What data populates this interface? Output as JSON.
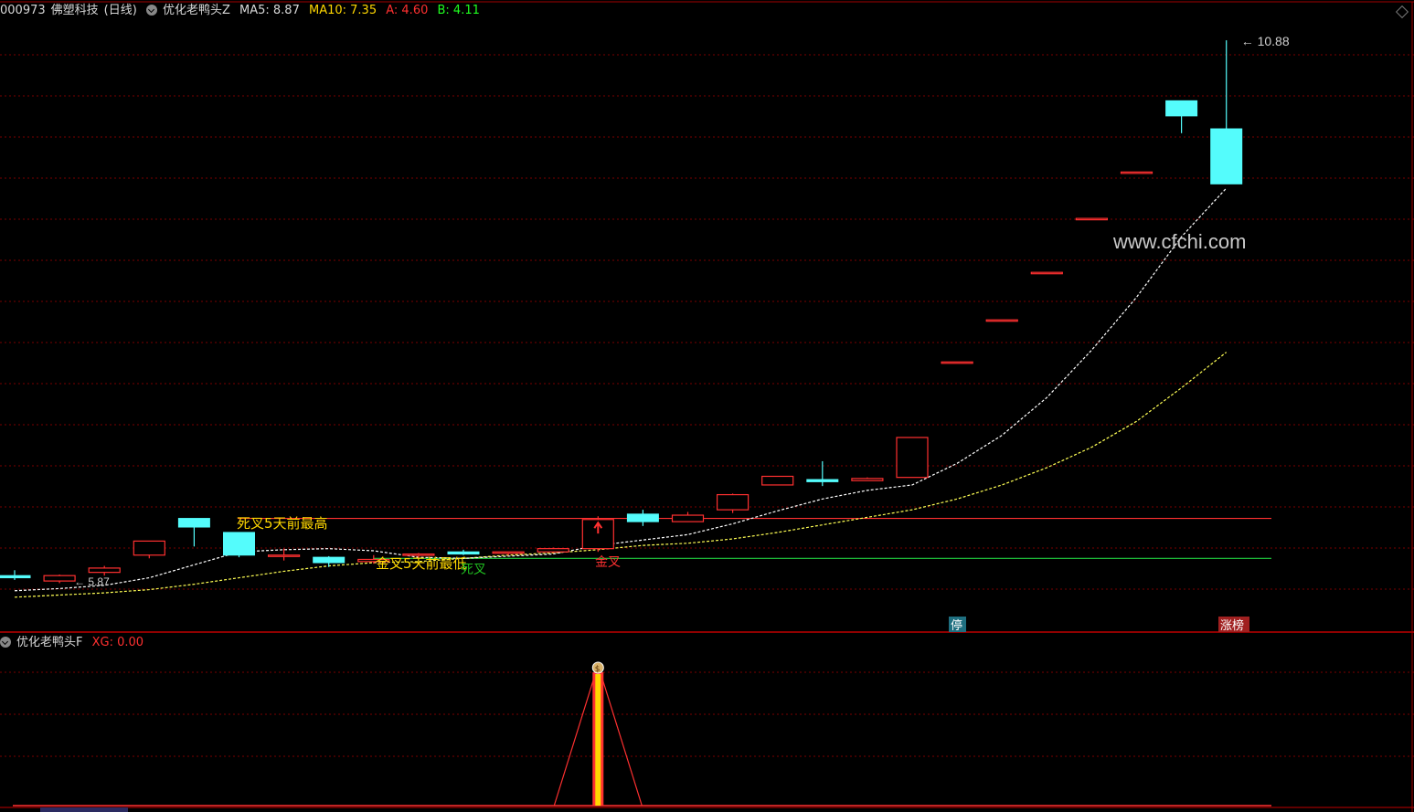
{
  "header": {
    "code": "000973",
    "name": "佛塑科技",
    "period": "(日线)",
    "indicator": "优化老鸭头Z",
    "ma5": "MA5: 8.87",
    "ma10": "MA10: 7.35",
    "a": "A: 4.60",
    "b": "B: 4.11"
  },
  "sub_header": {
    "indicator": "优化老鸭头F",
    "xg": "XG: 0.00"
  },
  "watermark": "www.cfchi.com",
  "annotations": {
    "high_label": "死叉5天前最高",
    "low_label": "金叉5天前最低",
    "dead_cross": "死叉",
    "golden_cross": "金叉",
    "stop_badge": "停",
    "top_badge": "涨榜",
    "max_price": "10.88",
    "min_price": "5.87"
  },
  "colors": {
    "up": "#ff3030",
    "down": "#54fcfc",
    "ma5": "#ffffff",
    "ma10": "#ffff54",
    "level_a": "#ff3030",
    "level_b": "#20d040",
    "grid": "#7a0000",
    "label": "#ffd700"
  },
  "chart_data": {
    "type": "candlestick",
    "ylim": [
      5.6,
      11.0
    ],
    "candles": [
      {
        "o": 5.92,
        "h": 5.97,
        "l": 5.88,
        "c": 5.9
      },
      {
        "o": 5.87,
        "h": 5.93,
        "l": 5.85,
        "c": 5.92
      },
      {
        "o": 5.95,
        "h": 6.01,
        "l": 5.92,
        "c": 5.99
      },
      {
        "o": 6.11,
        "h": 6.23,
        "l": 6.08,
        "c": 6.24
      },
      {
        "o": 6.45,
        "h": 6.45,
        "l": 6.19,
        "c": 6.37
      },
      {
        "o": 6.32,
        "h": 6.32,
        "l": 6.09,
        "c": 6.11
      },
      {
        "o": 6.11,
        "h": 6.17,
        "l": 6.06,
        "c": 6.11
      },
      {
        "o": 6.09,
        "h": 6.1,
        "l": 6.0,
        "c": 6.04
      },
      {
        "o": 6.05,
        "h": 6.11,
        "l": 6.03,
        "c": 6.07
      },
      {
        "o": 6.12,
        "h": 6.13,
        "l": 6.07,
        "c": 6.12
      },
      {
        "o": 6.14,
        "h": 6.16,
        "l": 6.11,
        "c": 6.12
      },
      {
        "o": 6.13,
        "h": 6.14,
        "l": 6.11,
        "c": 6.14
      },
      {
        "o": 6.14,
        "h": 6.18,
        "l": 6.13,
        "c": 6.17
      },
      {
        "o": 6.17,
        "h": 6.47,
        "l": 6.14,
        "c": 6.44
      },
      {
        "o": 6.49,
        "h": 6.53,
        "l": 6.38,
        "c": 6.42
      },
      {
        "o": 6.42,
        "h": 6.51,
        "l": 6.42,
        "c": 6.48
      },
      {
        "o": 6.53,
        "h": 6.68,
        "l": 6.5,
        "c": 6.67
      },
      {
        "o": 6.76,
        "h": 6.84,
        "l": 6.76,
        "c": 6.84
      },
      {
        "o": 6.81,
        "h": 6.98,
        "l": 6.75,
        "c": 6.79
      },
      {
        "o": 6.8,
        "h": 6.83,
        "l": 6.8,
        "c": 6.82
      },
      {
        "o": 6.83,
        "h": 7.2,
        "l": 6.83,
        "c": 7.2
      },
      {
        "o": 7.9,
        "h": 7.9,
        "l": 7.9,
        "c": 7.9
      },
      {
        "o": 8.29,
        "h": 8.29,
        "l": 8.29,
        "c": 8.29
      },
      {
        "o": 8.73,
        "h": 8.73,
        "l": 8.73,
        "c": 8.73
      },
      {
        "o": 9.23,
        "h": 9.23,
        "l": 9.23,
        "c": 9.23
      },
      {
        "o": 9.66,
        "h": 9.66,
        "l": 9.66,
        "c": 9.66
      },
      {
        "o": 10.32,
        "h": 10.32,
        "l": 10.02,
        "c": 10.18
      },
      {
        "o": 10.06,
        "h": 10.88,
        "l": 9.55,
        "c": 9.55
      }
    ],
    "ma5": [
      5.78,
      5.8,
      5.83,
      5.9,
      6.02,
      6.14,
      6.16,
      6.17,
      6.15,
      6.09,
      6.08,
      6.1,
      6.12,
      6.2,
      6.25,
      6.3,
      6.4,
      6.52,
      6.63,
      6.71,
      6.76,
      6.96,
      7.22,
      7.57,
      8.01,
      8.5,
      9.06,
      9.51
    ],
    "ma10": [
      5.72,
      5.74,
      5.76,
      5.79,
      5.84,
      5.9,
      5.96,
      6.01,
      6.04,
      6.05,
      6.08,
      6.11,
      6.13,
      6.16,
      6.2,
      6.22,
      6.26,
      6.32,
      6.39,
      6.46,
      6.53,
      6.63,
      6.76,
      6.92,
      7.11,
      7.35,
      7.66,
      7.99
    ],
    "levels": {
      "a": 6.45,
      "b": 6.08
    },
    "signal": {
      "index": 13,
      "value": 1
    }
  }
}
